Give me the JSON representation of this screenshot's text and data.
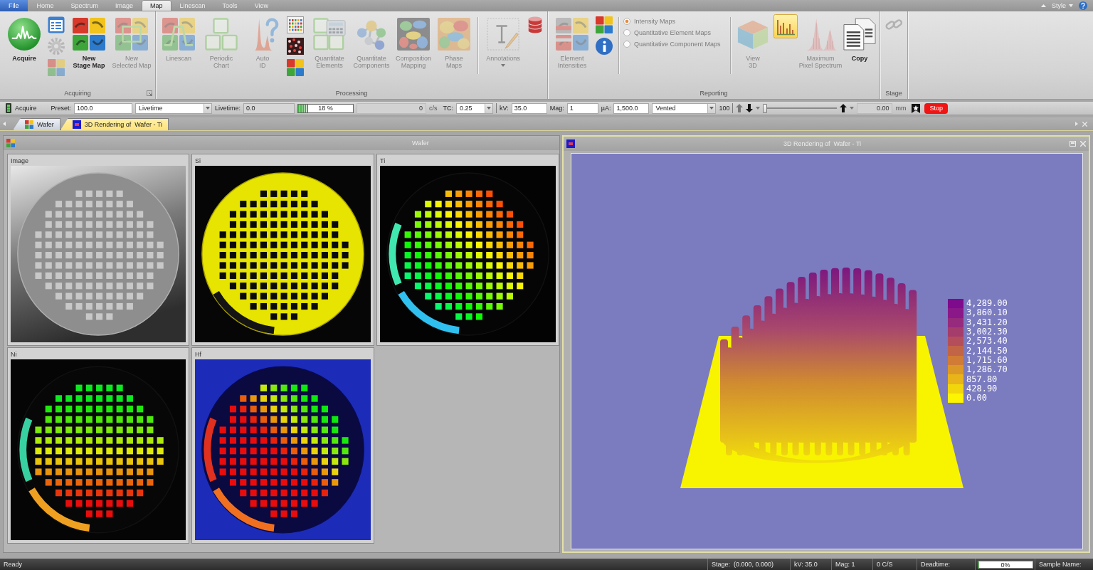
{
  "menu_tabs": [
    {
      "label": "File",
      "kind": "file",
      "selected": false
    },
    {
      "label": "Home",
      "kind": "tab",
      "selected": false
    },
    {
      "label": "Spectrum",
      "kind": "tab",
      "selected": false
    },
    {
      "label": "Image",
      "kind": "tab",
      "selected": false
    },
    {
      "label": "Map",
      "kind": "tab",
      "selected": true
    },
    {
      "label": "Linescan",
      "kind": "tab",
      "selected": false
    },
    {
      "label": "Tools",
      "kind": "tab",
      "selected": false
    },
    {
      "label": "View",
      "kind": "tab",
      "selected": false
    }
  ],
  "style_menu": {
    "label": "Style"
  },
  "ribbon": [
    {
      "label": "Acquiring",
      "launcher": true,
      "items": [
        {
          "kind": "large",
          "lines": [
            "Acquire"
          ],
          "disabled": false,
          "menu": false
        },
        {
          "kind": "icons",
          "buttons": [
            {
              "disabled": false
            },
            {
              "disabled": true
            },
            {
              "disabled": true
            }
          ]
        },
        {
          "kind": "large",
          "lines": [
            "New",
            "Stage Map"
          ],
          "disabled": false,
          "menu": false
        },
        {
          "kind": "large",
          "lines": [
            "New",
            "Selected Map"
          ],
          "disabled": true,
          "menu": false
        }
      ]
    },
    {
      "label": "Processing",
      "launcher": false,
      "items": [
        {
          "kind": "large",
          "lines": [
            "Linescan"
          ],
          "disabled": true,
          "menu": false
        },
        {
          "kind": "large",
          "lines": [
            "Periodic",
            "Chart"
          ],
          "disabled": true,
          "menu": false
        },
        {
          "kind": "large",
          "lines": [
            "Auto",
            "ID"
          ],
          "disabled": true,
          "menu": false
        },
        {
          "kind": "icons",
          "buttons": [
            {
              "disabled": false
            },
            {
              "disabled": false
            },
            {
              "disabled": false
            }
          ]
        },
        {
          "kind": "large",
          "lines": [
            "Quantitate",
            "Elements"
          ],
          "disabled": true,
          "menu": false
        },
        {
          "kind": "large",
          "lines": [
            "Quantitate",
            "Components"
          ],
          "disabled": true,
          "menu": false
        },
        {
          "kind": "large",
          "lines": [
            "Composition",
            "Mapping"
          ],
          "disabled": true,
          "menu": false
        },
        {
          "kind": "large",
          "lines": [
            "Phase",
            "Maps"
          ],
          "disabled": true,
          "menu": false
        },
        {
          "kind": "separator"
        },
        {
          "kind": "large",
          "lines": [
            "Annotations"
          ],
          "disabled": true,
          "menu": true
        },
        {
          "kind": "icons",
          "buttons": [
            {
              "disabled": false
            }
          ]
        }
      ]
    },
    {
      "label": "Reporting",
      "launcher": false,
      "items": [
        {
          "kind": "large",
          "lines": [
            "Element",
            "Intensities"
          ],
          "disabled": true,
          "menu": false
        },
        {
          "kind": "icons",
          "buttons": [
            {
              "disabled": false
            },
            {
              "disabled": false
            }
          ]
        },
        {
          "kind": "separator"
        },
        {
          "kind": "radios",
          "options": [
            {
              "label": "Intensity Maps",
              "selected": true
            },
            {
              "label": "Quantitative Element Maps",
              "selected": false
            },
            {
              "label": "Quantitative Component Maps",
              "selected": false
            }
          ]
        },
        {
          "kind": "separator"
        },
        {
          "kind": "large",
          "lines": [
            "View",
            "3D"
          ],
          "disabled": true,
          "menu": false
        },
        {
          "kind": "toggle",
          "on": true
        },
        {
          "kind": "large",
          "lines": [
            "Maximum",
            "Pixel Spectrum"
          ],
          "disabled": true,
          "menu": false
        },
        {
          "kind": "large",
          "lines": [
            "Copy"
          ],
          "disabled": false,
          "menu": false
        }
      ]
    },
    {
      "label": "Stage",
      "launcher": false,
      "items": [
        {
          "kind": "icons",
          "buttons": [
            {
              "disabled": true
            }
          ]
        }
      ]
    }
  ],
  "toolbar": [
    {
      "kind": "button",
      "label": "Acquire"
    },
    {
      "kind": "field",
      "label": "Preset:",
      "value": "100.0",
      "disabled": false
    },
    {
      "kind": "dropdown",
      "value": "Livetime"
    },
    {
      "kind": "field",
      "label": "Livetime:",
      "value": "0.0",
      "disabled": true
    },
    {
      "kind": "progress",
      "level": 0.18,
      "text": "18 %"
    },
    {
      "kind": "readout",
      "value": "0",
      "unit": "c/s"
    },
    {
      "kind": "dropdown",
      "label": "TC:",
      "value": "0.25"
    },
    {
      "kind": "field",
      "label": "kV:",
      "value": "35.0",
      "disabled": false
    },
    {
      "kind": "field",
      "label": "Mag:",
      "value": "1",
      "disabled": false
    },
    {
      "kind": "field",
      "label": "µA:",
      "value": "1,500.0",
      "disabled": false
    },
    {
      "kind": "dropdown",
      "value": "Vented"
    },
    {
      "kind": "text",
      "text": "100"
    },
    {
      "kind": "arrow_up",
      "disabled": true,
      "menu": false
    },
    {
      "kind": "arrow_down",
      "disabled": false,
      "menu": true
    },
    {
      "kind": "slider",
      "level": 0
    },
    {
      "kind": "arrow_up",
      "disabled": false,
      "menu": true
    },
    {
      "kind": "readout",
      "value": "0.00",
      "unit": "mm"
    },
    {
      "kind": "bookmark"
    },
    {
      "kind": "stop",
      "label": "Stop"
    }
  ],
  "document_tabs": [
    {
      "label": "Wafer",
      "selected": false
    },
    {
      "label": "3D Rendering of  Wafer - Ti",
      "selected": true
    }
  ],
  "wafer_window": {
    "title": "Wafer",
    "maps": [
      {
        "label": "Image",
        "kind": "grayscale"
      },
      {
        "label": "Si",
        "kind": "yellow"
      },
      {
        "label": "Ti",
        "kind": "rainbow"
      },
      {
        "label": "Ni",
        "kind": "green_red"
      },
      {
        "label": "Hf",
        "kind": "blue_field"
      }
    ]
  },
  "render_window": {
    "title": "3D Rendering of  Wafer - Ti",
    "legend": [
      {
        "value": "4,289.00",
        "color": "#7e0a8c"
      },
      {
        "value": "3,860.10",
        "color": "#8a1888"
      },
      {
        "value": "3,431.20",
        "color": "#962a7c"
      },
      {
        "value": "3,002.30",
        "color": "#a43c6c"
      },
      {
        "value": "2,573.40",
        "color": "#b44e5a"
      },
      {
        "value": "2,144.50",
        "color": "#c26446"
      },
      {
        "value": "1,715.60",
        "color": "#d07c36"
      },
      {
        "value": "1,286.70",
        "color": "#dc9826"
      },
      {
        "value": "857.80",
        "color": "#e8b41a"
      },
      {
        "value": "428.90",
        "color": "#f2d60c"
      },
      {
        "value": "0.00",
        "color": "#fcf400"
      }
    ]
  },
  "status_bar": [
    {
      "kind": "text",
      "text": "Ready"
    },
    {
      "kind": "text",
      "text": "Stage:  (0.000, 0.000)"
    },
    {
      "kind": "text",
      "text": "kV: 35.0"
    },
    {
      "kind": "text",
      "text": "Mag: 1"
    },
    {
      "kind": "text",
      "text": "0 C/S"
    },
    {
      "kind": "text",
      "text": "Deadtime:"
    },
    {
      "kind": "progress",
      "level": 0,
      "text": "0%"
    },
    {
      "kind": "text",
      "text": "Sample Name:"
    }
  ]
}
